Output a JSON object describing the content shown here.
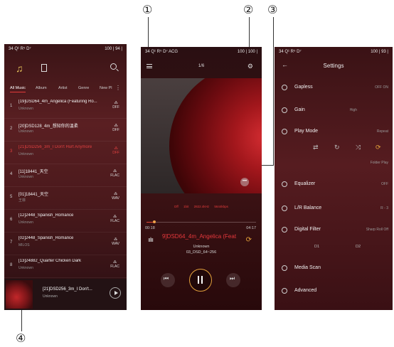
{
  "callouts": [
    "①",
    "②",
    "③",
    "④"
  ],
  "screen1": {
    "status_left": "34 Q¹ R⁵ D⁷",
    "status_right": "100 | 94 |",
    "tabs": [
      "All Music",
      "Album",
      "Artist",
      "Genre",
      "New Pl"
    ],
    "tracks": [
      {
        "num": "1",
        "title": "[19]DSD64_4m_Angelica (Featuring Ro...",
        "artist": "Unknown",
        "fmt": "DFF",
        "red": false
      },
      {
        "num": "2",
        "title": "[20]DSD128_4m_想知你的溫柔",
        "artist": "Unknown",
        "fmt": "DFF",
        "red": false
      },
      {
        "num": "3",
        "title": "[21]DSD256_3m_I Don't Hurt Anymore",
        "artist": "Unknown",
        "fmt": "DFF",
        "red": true
      },
      {
        "num": "4",
        "title": "[11]18441_天空",
        "artist": "Unknown",
        "fmt": "FLAC",
        "red": false
      },
      {
        "num": "5",
        "title": "[01]18441_天空",
        "artist": "王菲",
        "fmt": "WAV",
        "red": false
      },
      {
        "num": "6",
        "title": "[12]2448_Spanish_Romance",
        "artist": "Unknown",
        "fmt": "FLAC",
        "red": false
      },
      {
        "num": "7",
        "title": "[02]2448_Spanish_Romance",
        "artist": "MILOS",
        "fmt": "WAV",
        "red": false
      },
      {
        "num": "8",
        "title": "[13]24882_Quarter Chicken Dark",
        "artist": "Unknown",
        "fmt": "FLAC",
        "red": false
      }
    ],
    "mini_title": "[21]DSD256_3m_I Don't...",
    "mini_artist": "Unknown"
  },
  "screen2": {
    "status_left": "34 Q¹ R⁵ D⁷ ACG",
    "status_right": "100 | 100 |",
    "page": "1/6",
    "specs": [
      "Dff",
      "1bit",
      "2822.4kHz",
      "5644kbps"
    ],
    "time_elapsed": "00:18",
    "time_total": "04:17",
    "progress": 0.07,
    "song": "9]DSD64_4m_Angelica (Feat",
    "artist": "Unknown",
    "album": "03_DSD_64~256"
  },
  "screen3": {
    "status_left": "34 Q¹ R⁵ D⁷",
    "status_right": "100 | 93 |",
    "title": "Settings",
    "items": [
      {
        "label": "Gapless",
        "value": "OFF    ON"
      },
      {
        "label": "Gain",
        "value": "High"
      },
      {
        "label": "Play Mode",
        "value": "Repeat"
      },
      {
        "label": "Equalizer",
        "value": "OFF"
      },
      {
        "label": "L/R Balance",
        "value": "R - 3"
      },
      {
        "label": "Digital Filter",
        "value": "Sharp Roll Off"
      },
      {
        "label": "Media Scan",
        "value": ""
      },
      {
        "label": "Advanced",
        "value": ""
      }
    ],
    "folder_play": "Folder Play",
    "d1": "D1",
    "d2": "D2"
  }
}
